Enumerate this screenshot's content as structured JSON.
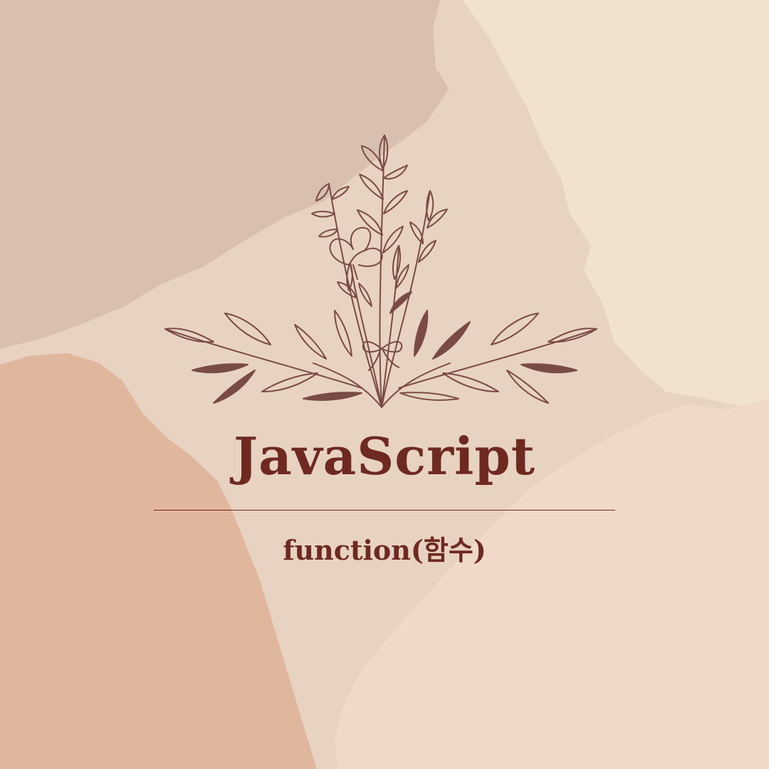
{
  "palette": {
    "base": "#e8d2c2",
    "blob_top_left": "#d8bfb0",
    "blob_top_right": "#f1e1cf",
    "blob_bottom_left": "#e0b69c",
    "blob_bottom_right": "#f1d9c9",
    "ink": "#6e2a22",
    "illustration": "#7a4a44"
  },
  "illustration": {
    "icon": "floral-bouquet-icon"
  },
  "title": "JavaScript",
  "subtitle": "function(함수)"
}
